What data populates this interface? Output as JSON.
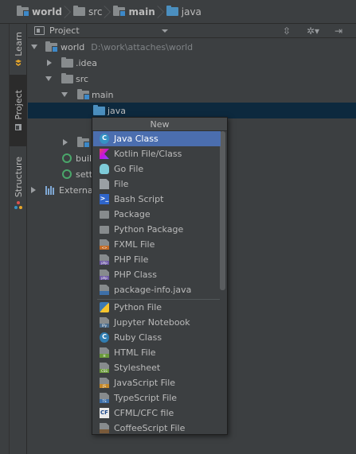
{
  "breadcrumb": [
    {
      "label": "world",
      "bold": true,
      "module": true
    },
    {
      "label": "src",
      "bold": false,
      "module": false
    },
    {
      "label": "main",
      "bold": true,
      "module": true
    },
    {
      "label": "java",
      "bold": false,
      "module": false,
      "blue": true
    }
  ],
  "toolwindows": {
    "learn": "Learn",
    "project": "Project",
    "structure": "Structure"
  },
  "panel": {
    "title": "Project",
    "tree": [
      {
        "label": "world",
        "path": "D:\\work\\attaches\\world"
      },
      {
        "label": ".idea"
      },
      {
        "label": "src"
      },
      {
        "label": "main"
      },
      {
        "label": "java"
      },
      {
        "label": "buil"
      },
      {
        "label": "setti"
      },
      {
        "label": "External"
      }
    ]
  },
  "menu": {
    "title": "New",
    "items": [
      "Java Class",
      "Kotlin File/Class",
      "Go File",
      "File",
      "Bash Script",
      "Package",
      "Python Package",
      "FXML File",
      "PHP File",
      "PHP Class",
      "package-info.java",
      "Python File",
      "Jupyter Notebook",
      "Ruby Class",
      "HTML File",
      "Stylesheet",
      "JavaScript File",
      "TypeScript File",
      "CFML/CFC file",
      "CoffeeScript File"
    ],
    "badges": {
      "fxml": "<>",
      "php": "php",
      "jupyter": "IPy",
      "html": "H",
      "css": "CSS",
      "js": "JS",
      "ts": "TS",
      "cfml": "CF",
      "bash": ">_",
      "java": "C",
      "ruby": "C"
    }
  },
  "colors": {
    "background": "#3c3f41",
    "selection": "#0d293e",
    "menu_highlight": "#4b6eaf",
    "folder_blue": "#4b8fbf"
  }
}
